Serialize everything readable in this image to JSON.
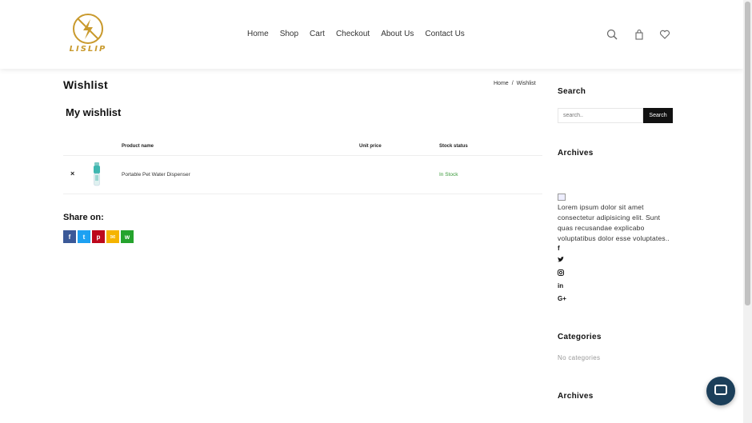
{
  "header": {
    "logo_text": "LISLIP",
    "nav": [
      "Home",
      "Shop",
      "Cart",
      "Checkout",
      "About Us",
      "Contact Us"
    ],
    "icons": [
      "search-icon",
      "cart-bag-icon",
      "heart-icon"
    ]
  },
  "page": {
    "title": "Wishlist",
    "breadcrumb": {
      "home": "Home",
      "sep": "/",
      "current": "Wishlist"
    },
    "subtitle": "My wishlist"
  },
  "table": {
    "columns": {
      "product": "Product name",
      "price": "Unit price",
      "stock": "Stock status"
    },
    "rows": [
      {
        "remove": "×",
        "product": "Portable Pet Water Dispenser",
        "price": "",
        "stock": "In Stock"
      }
    ]
  },
  "share": {
    "title": "Share on:",
    "buttons": [
      {
        "name": "facebook",
        "glyph": "f",
        "color": "#3b5998"
      },
      {
        "name": "twitter",
        "glyph": "t",
        "color": "#1da1f2"
      },
      {
        "name": "pinterest",
        "glyph": "p",
        "color": "#bd081c"
      },
      {
        "name": "email",
        "glyph": "✉",
        "color": "#f5b400"
      },
      {
        "name": "whatsapp",
        "glyph": "w",
        "color": "#25a32d"
      }
    ]
  },
  "sidebar": {
    "search_title": "Search",
    "search_placeholder": "search..",
    "search_button": "Search",
    "archives_title": "Archives",
    "about_text": "Lorem ipsum dolor sit amet consectetur adipisicing elit. Sunt quas recusandae explicabo voluptatibus dolor esse voluptates..",
    "social": [
      "f",
      "t",
      "ig",
      "in",
      "G+"
    ],
    "categories_title": "Categories",
    "no_categories": "No categories",
    "archives_title_2": "Archives"
  },
  "colors": {
    "accent_gold": "#c99a2e",
    "in_stock": "#3a9a3a",
    "chat": "#1c3f5a"
  }
}
